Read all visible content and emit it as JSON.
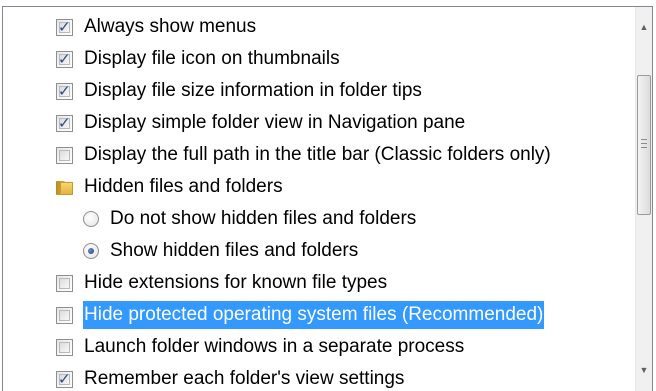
{
  "partial_header": "       ",
  "items": [
    {
      "type": "checkbox",
      "label": "Always show menus",
      "checked": true
    },
    {
      "type": "checkbox",
      "label": "Display file icon on thumbnails",
      "checked": true
    },
    {
      "type": "checkbox",
      "label": "Display file size information in folder tips",
      "checked": true
    },
    {
      "type": "checkbox",
      "label": "Display simple folder view in Navigation pane",
      "checked": true
    },
    {
      "type": "checkbox",
      "label": "Display the full path in the title bar (Classic folders only)",
      "checked": false
    },
    {
      "type": "folder",
      "label": "Hidden files and folders"
    },
    {
      "type": "radio",
      "label": "Do not show hidden files and folders",
      "checked": false
    },
    {
      "type": "radio",
      "label": "Show hidden files and folders",
      "checked": true
    },
    {
      "type": "checkbox",
      "label": "Hide extensions for known file types",
      "checked": false
    },
    {
      "type": "checkbox",
      "label": "Hide protected operating system files (Recommended)",
      "checked": false,
      "selected": true
    },
    {
      "type": "checkbox",
      "label": "Launch folder windows in a separate process",
      "checked": false
    },
    {
      "type": "checkbox",
      "label": "Remember each folder's view settings",
      "checked": true
    }
  ],
  "colors": {
    "selection": "#3399ff",
    "check": "#2a4a8b",
    "border": "#828790"
  }
}
